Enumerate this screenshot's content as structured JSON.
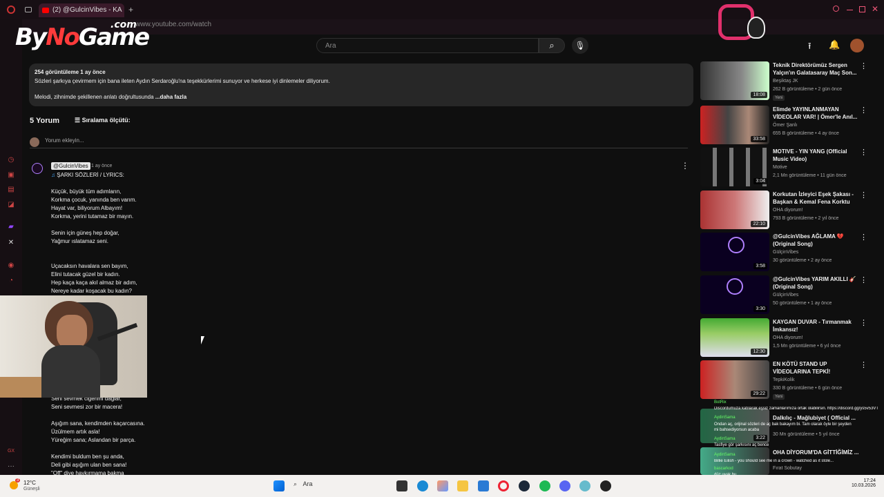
{
  "browser": {
    "tab_title": "(2) @GulcinVibes - KA",
    "url": "www.youtube.com/watch",
    "new_tab": "+"
  },
  "logo": {
    "text_by": "By",
    "text_no": "No",
    "text_game": "Game",
    "text_com": ".com"
  },
  "header": {
    "search_placeholder": "Ara"
  },
  "description": {
    "meta": "254 görüntüleme  1 ay önce",
    "line1": "Sözleri şarkıya çevirmem için bana ileten Aydın Serdaroğlu'na teşekkürlerimi sunuyor ve herkese iyi dinlemeler diliyorum.",
    "line2": "Melodi, zihnimde şekillenen anlatı doğrultusunda",
    "more": "...daha fazla"
  },
  "comments": {
    "count": "5 Yorum",
    "sort_label": "Sıralama ölçütü:",
    "add_placeholder": "Yorum ekleyin...",
    "first": {
      "handle": "@GulcinVibes",
      "time": "1 ay önce",
      "header_line": "ŞARKI SÖZLERİ / LYRICS:",
      "lines": [
        "Küçük, büyük tüm adımların,",
        "Korkma çocuk, yanında ben varım.",
        "Hayat var, biliyorum Albayım!",
        "Korkma, yerini tutamaz bir mayın.",
        "Senin için güneş hep doğar,",
        "Yağmur ıslatamaz seni.",
        "Uçacaksın havalara sen bayım,",
        "Elini tutacak güzel bir kadın.",
        "Hep kaça kaça akıl almaz bir adım,",
        "Nereye kadar koşacak bu kadın?",
        "Seni sevmek ciğerimi dağlar,",
        "Seni sevmesi zor bir macera!",
        "Aşığım sana, kendimden kaçarcasına.",
        "Üzülmem artık asla!",
        "Yüreğim sana; Aslandan bir parça.",
        "Kendimi buldum ben şu anda,",
        "Deli gibi aşığım ulan ben sana!",
        "\"Off\" diye haykırmama bakma"
      ]
    }
  },
  "sidebar_videos": [
    {
      "title": "Teknik Direktörümüz Sergen Yalçın'ın Galatasaray Maç Son...",
      "channel": "Beşiktaş JK",
      "stats": "262 B görüntüleme • 2 gün önce",
      "duration": "18:08",
      "badge": "Yeni"
    },
    {
      "title": "Elimde YAYINLANMAYAN VİDEOLAR VAR! | Ömer'le Anıl...",
      "channel": "Ömer Şanlı",
      "stats": "655 B görüntüleme • 4 ay önce",
      "duration": "33:58",
      "badge": ""
    },
    {
      "title": "MOTIVE - YIN YANG (Official Music Video)",
      "channel": "Motive",
      "stats": "2,1 Mn görüntüleme • 11 gün önce",
      "duration": "3:04",
      "badge": ""
    },
    {
      "title": "Korkutan İzleyici Eşek Şakası - Başkan & Kemal Fena Korktu",
      "channel": "OHA diyorum!",
      "stats": "793 B görüntüleme • 2 yıl önce",
      "duration": "22:10",
      "badge": ""
    },
    {
      "title": "@GulcinVibes  AĞLAMA 💔 (Original Song)",
      "channel": "GülçinVibes",
      "stats": "30 görüntüleme • 2 ay önce",
      "duration": "3:58",
      "badge": ""
    },
    {
      "title": "@GulcinVibes  YARIM AKILLI 🎸 (Original Song)",
      "channel": "GülçinVibes",
      "stats": "50 görüntüleme • 1 ay önce",
      "duration": "3:30",
      "badge": ""
    },
    {
      "title": "KAYGAN DUVAR - Tırmanmak İmkansız!",
      "channel": "OHA diyorum!",
      "stats": "1,5 Mn görüntüleme • 6 yıl önce",
      "duration": "12:30",
      "badge": ""
    },
    {
      "title": "EN KÖTÜ STAND UP VİDEOLARINA TEPKİ!",
      "channel": "TepkiKolik",
      "stats": "330 B görüntüleme • 6 gün önce",
      "duration": "29:22",
      "badge": "Yeni"
    },
    {
      "title": "Dalkılıç - Mağlubiyet ( Official ...",
      "channel": "",
      "stats": "30 Mn görüntüleme • 5 yıl önce",
      "duration": "3:22",
      "badge": ""
    },
    {
      "title": "OHA DİYORUM'DA GİTTİĞİMİZ ...",
      "channel": "Fırat Sobutay",
      "stats": "",
      "duration": "",
      "badge": ""
    }
  ],
  "chat": {
    "user1": "BotRix",
    "msg1": "Discordumuza katılarak eşsiz zamanlarımıza ortak olabilirsin. https://discord.gg/ys5v53VT",
    "user2": "AydinSama",
    "msg2": "Ondan aç, orijinal sözleri de aç bak bakayım bi. Tam olarak öyle bir şeyden mi bahsediyorsun acaba",
    "user3": "AydinSama",
    "msg3": "Tasfiye gör şarkısını aç bence",
    "user4": "AydinSama",
    "msg4": "Billie Eilish - you should see me in a crown - watched as it stole...",
    "user5": "bascarkod",
    "msg5": "düz uyak bu"
  },
  "taskbar": {
    "weather_temp": "12°C",
    "weather_label": "Güneşli",
    "search": "Ara",
    "time": "17:24",
    "date": "10.03.2026",
    "notif": "3"
  }
}
